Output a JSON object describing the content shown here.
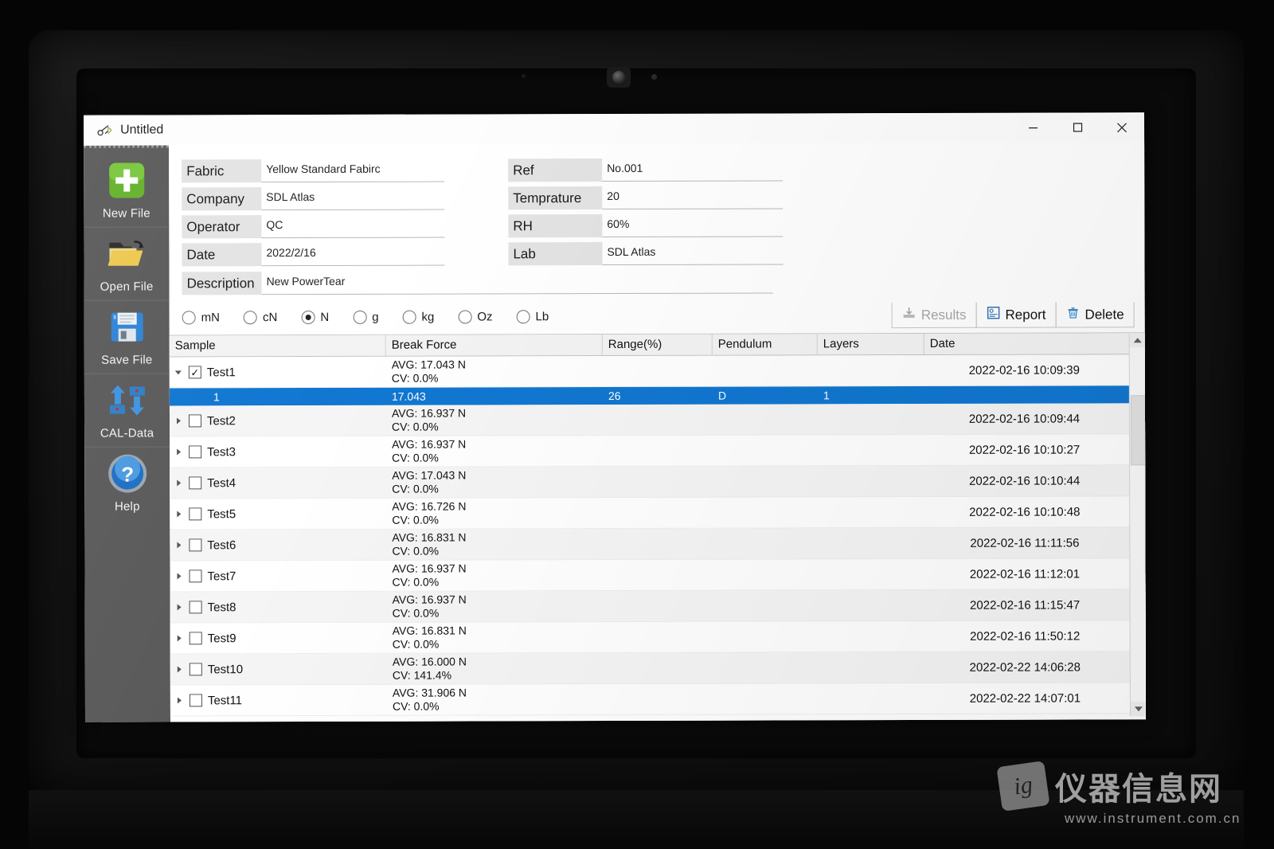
{
  "window": {
    "title": "Untitled",
    "title_icon": "tear-tester-icon",
    "controls": {
      "minimize": "–",
      "maximize": "☐",
      "close": "✕"
    }
  },
  "sidebar": {
    "items": [
      {
        "label": "New File",
        "icon": "new-file-icon"
      },
      {
        "label": "Open File",
        "icon": "open-folder-icon"
      },
      {
        "label": "Save File",
        "icon": "floppy-disk-icon"
      },
      {
        "label": "CAL-Data",
        "icon": "calibration-arrows-icon"
      },
      {
        "label": "Help",
        "icon": "question-mark-icon"
      }
    ]
  },
  "form": {
    "left": [
      {
        "label": "Fabric",
        "value": "Yellow Standard Fabirc"
      },
      {
        "label": "Company",
        "value": "SDL Atlas"
      },
      {
        "label": "Operator",
        "value": "QC"
      },
      {
        "label": "Date",
        "value": "2022/2/16"
      }
    ],
    "right": [
      {
        "label": "Ref",
        "value": "No.001"
      },
      {
        "label": "Temprature",
        "value": "20"
      },
      {
        "label": "RH",
        "value": "60%"
      },
      {
        "label": "Lab",
        "value": "SDL Atlas"
      }
    ],
    "description": {
      "label": "Description",
      "value": "New PowerTear"
    }
  },
  "units": {
    "selected": "N",
    "options": [
      "mN",
      "cN",
      "N",
      "g",
      "kg",
      "Oz",
      "Lb"
    ]
  },
  "actions": [
    {
      "label": "Results",
      "icon": "results-download-icon",
      "enabled": false
    },
    {
      "label": "Report",
      "icon": "report-page-icon",
      "enabled": true
    },
    {
      "label": "Delete",
      "icon": "trash-can-icon",
      "enabled": true
    }
  ],
  "table": {
    "columns": [
      "Sample",
      "Break Force",
      "Range(%)",
      "Pendulum",
      "Layers",
      "Date"
    ],
    "rows": [
      {
        "kind": "group",
        "sample": "Test1",
        "expanded": true,
        "checked": true,
        "avg": "AVG: 17.043 N",
        "cv": "CV: 0.0%",
        "range": "",
        "pendulum": "",
        "layers": "",
        "date": "2022-02-16 10:09:39"
      },
      {
        "kind": "child",
        "selected": true,
        "sample": "1",
        "break_force": "17.043",
        "range": "26",
        "pendulum": "D",
        "layers": "1",
        "date": ""
      },
      {
        "kind": "group",
        "sample": "Test2",
        "expanded": false,
        "checked": false,
        "avg": "AVG: 16.937 N",
        "cv": "CV: 0.0%",
        "range": "",
        "pendulum": "",
        "layers": "",
        "date": "2022-02-16 10:09:44"
      },
      {
        "kind": "group",
        "sample": "Test3",
        "expanded": false,
        "checked": false,
        "avg": "AVG: 16.937 N",
        "cv": "CV: 0.0%",
        "range": "",
        "pendulum": "",
        "layers": "",
        "date": "2022-02-16 10:10:27"
      },
      {
        "kind": "group",
        "sample": "Test4",
        "expanded": false,
        "checked": false,
        "avg": "AVG: 17.043 N",
        "cv": "CV: 0.0%",
        "range": "",
        "pendulum": "",
        "layers": "",
        "date": "2022-02-16 10:10:44"
      },
      {
        "kind": "group",
        "sample": "Test5",
        "expanded": false,
        "checked": false,
        "avg": "AVG: 16.726 N",
        "cv": "CV: 0.0%",
        "range": "",
        "pendulum": "",
        "layers": "",
        "date": "2022-02-16 10:10:48"
      },
      {
        "kind": "group",
        "sample": "Test6",
        "expanded": false,
        "checked": false,
        "avg": "AVG: 16.831 N",
        "cv": "CV: 0.0%",
        "range": "",
        "pendulum": "",
        "layers": "",
        "date": "2022-02-16 11:11:56"
      },
      {
        "kind": "group",
        "sample": "Test7",
        "expanded": false,
        "checked": false,
        "avg": "AVG: 16.937 N",
        "cv": "CV: 0.0%",
        "range": "",
        "pendulum": "",
        "layers": "",
        "date": "2022-02-16 11:12:01"
      },
      {
        "kind": "group",
        "sample": "Test8",
        "expanded": false,
        "checked": false,
        "avg": "AVG: 16.937 N",
        "cv": "CV: 0.0%",
        "range": "",
        "pendulum": "",
        "layers": "",
        "date": "2022-02-16 11:15:47"
      },
      {
        "kind": "group",
        "sample": "Test9",
        "expanded": false,
        "checked": false,
        "avg": "AVG: 16.831 N",
        "cv": "CV: 0.0%",
        "range": "",
        "pendulum": "",
        "layers": "",
        "date": "2022-02-16 11:50:12"
      },
      {
        "kind": "group",
        "sample": "Test10",
        "expanded": false,
        "checked": false,
        "avg": "AVG: 16.000 N",
        "cv": "CV: 141.4%",
        "range": "",
        "pendulum": "",
        "layers": "",
        "date": "2022-02-22 14:06:28"
      },
      {
        "kind": "group",
        "sample": "Test11",
        "expanded": false,
        "checked": false,
        "avg": "AVG: 31.906 N",
        "cv": "CV: 0.0%",
        "range": "",
        "pendulum": "",
        "layers": "",
        "date": "2022-02-22 14:07:01"
      }
    ]
  },
  "watermark": {
    "badge": "ig",
    "name": "仪器信息网",
    "url": "www.instrument.com.cn"
  },
  "colors": {
    "accent": "#1177d1",
    "sidebar": "#5a5a5a",
    "label_bg": "#e3e3e3",
    "new_file_green": "#5aad2a"
  }
}
